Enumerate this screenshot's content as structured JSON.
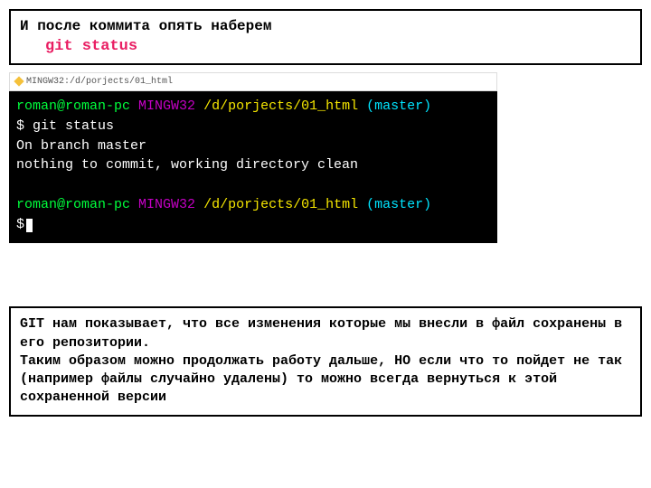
{
  "instruction": {
    "line1": "И после коммита опять наберем",
    "cmd": "git status"
  },
  "titlebar": "MINGW32:/d/porjects/01_html",
  "term": {
    "user": "roman@roman-pc",
    "host": "MINGW32",
    "path": "/d/porjects/01_html",
    "branch": "(master)",
    "dollar": "$",
    "cmd": "git status",
    "out1": "On branch master",
    "out2": "nothing to commit, working directory clean"
  },
  "explain": {
    "p1": "GIT нам показывает, что все изменения которые мы внесли в файл сохранены в его репозитории.",
    "p2": "Таким образом можно продолжать работу  дальше, НО если что то пойдет не так (например файлы случайно удалены) то можно всегда вернуться к этой сохраненной версии"
  }
}
